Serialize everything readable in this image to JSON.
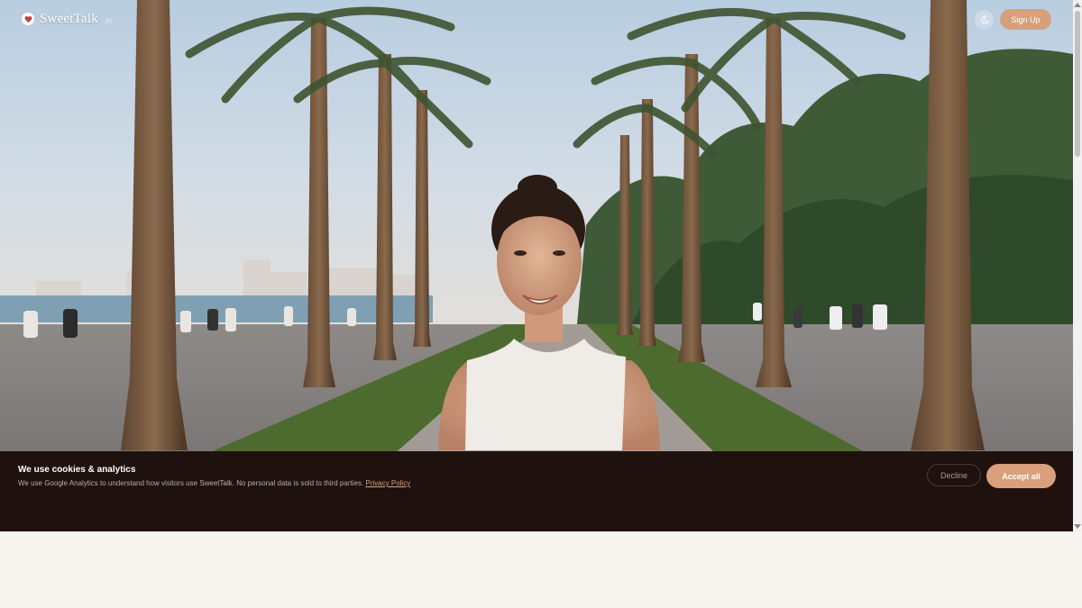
{
  "nav": {
    "brand_name": "SweetTalk",
    "brand_tag": "AI",
    "signup_label": "Sign Up",
    "theme_icon": "moon-icon",
    "brand_icon": "heart-icon"
  },
  "hero": {
    "image_alt": "Smiling woman on a palm-lined seaside promenade"
  },
  "cookie_banner": {
    "title": "We use cookies & analytics",
    "description": "We use Google Analytics to understand how visitors use SweetTalk. No personal data is sold to third parties.",
    "privacy_link": "Privacy Policy",
    "decline_label": "Decline",
    "accept_label": "Accept all"
  },
  "colors": {
    "accent": "#d9a07b",
    "banner_bg": "#1f110d",
    "page_bg": "#f8f5f0"
  }
}
